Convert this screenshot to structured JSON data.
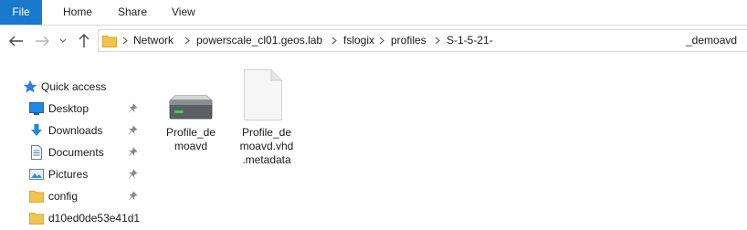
{
  "ribbon": {
    "tabs": [
      {
        "label": "File"
      },
      {
        "label": "Home"
      },
      {
        "label": "Share"
      },
      {
        "label": "View"
      }
    ]
  },
  "address": {
    "crumbs": [
      "Network",
      "powerscale_cl01.geos.lab",
      "fslogix",
      "profiles",
      "S-1-5-21-",
      "_demoavd"
    ]
  },
  "navigation": {
    "quick_access": "Quick access",
    "items": [
      {
        "label": "Desktop",
        "icon": "desktop-icon",
        "pinned": true
      },
      {
        "label": "Downloads",
        "icon": "downloads-icon",
        "pinned": true
      },
      {
        "label": "Documents",
        "icon": "documents-icon",
        "pinned": true
      },
      {
        "label": "Pictures",
        "icon": "pictures-icon",
        "pinned": true
      },
      {
        "label": "config",
        "icon": "folder-icon",
        "pinned": true
      },
      {
        "label": "d10ed0de53e41d1",
        "icon": "folder-icon",
        "pinned": false
      }
    ]
  },
  "files": [
    {
      "label": "Profile_de\nmoavd",
      "icon": "virtual-disk-icon"
    },
    {
      "label": "Profile_de\nmoavd.vhd\n.metadata",
      "icon": "blank-file-icon"
    }
  ],
  "colors": {
    "accent": "#1979ca",
    "folder": "#f0c54f",
    "border": "#d9d9d9"
  }
}
